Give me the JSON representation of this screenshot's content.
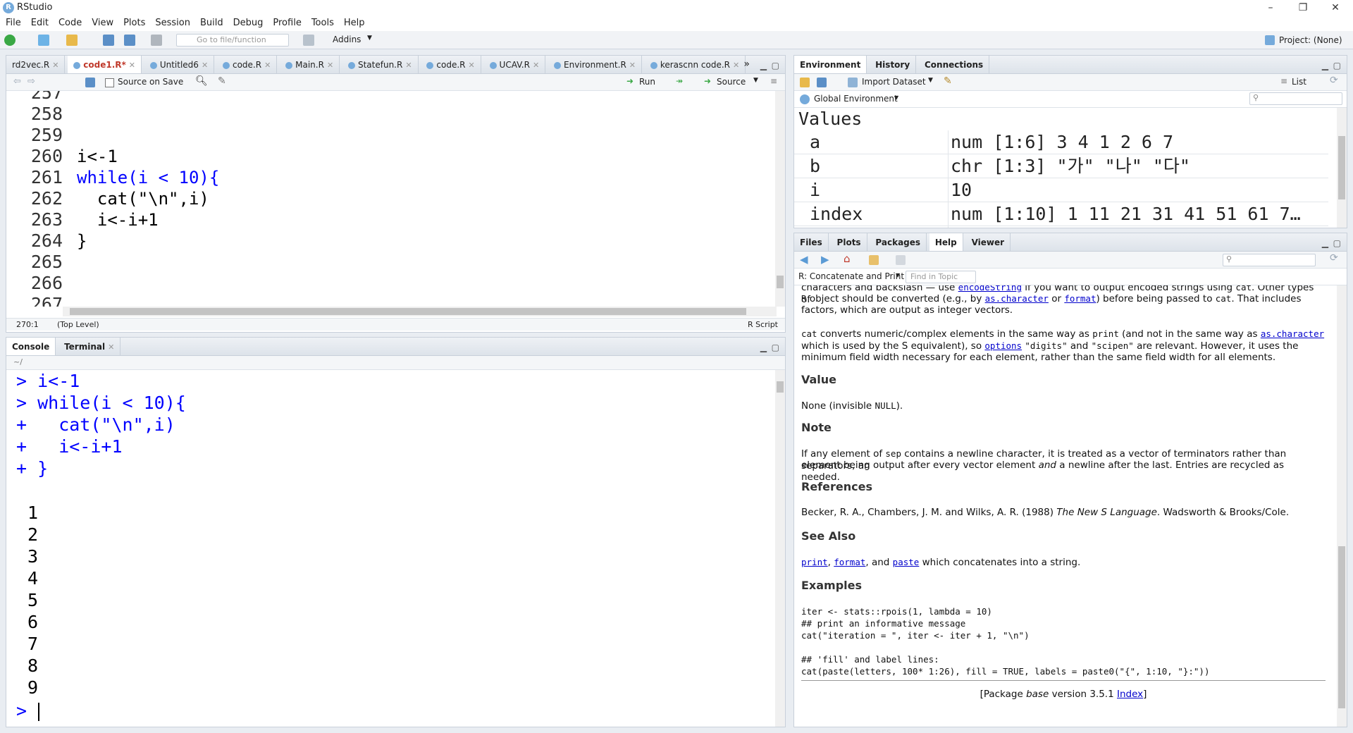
{
  "window": {
    "title": "RStudio",
    "minimize": "–",
    "restore": "❐",
    "close": "✕"
  },
  "menu": [
    "File",
    "Edit",
    "Code",
    "View",
    "Plots",
    "Session",
    "Build",
    "Debug",
    "Profile",
    "Tools",
    "Help"
  ],
  "toolbar": {
    "goto_placeholder": "Go to file/function",
    "addins": "Addins",
    "project": "Project: (None)"
  },
  "editor": {
    "tabs": [
      "rd2vec.R",
      "code1.R*",
      "Untitled6",
      "code.R",
      "Main.R",
      "Statefun.R",
      "code.R",
      "UCAV.R",
      "Environment.R",
      "kerascnn code.R"
    ],
    "active_tab": 1,
    "source_on_save": "Source on Save",
    "run": "Run",
    "source": "Source",
    "lines": [
      {
        "n": "258",
        "t": ""
      },
      {
        "n": "259",
        "t": ""
      },
      {
        "n": "260",
        "t": "i<-1"
      },
      {
        "n": "261",
        "t": "while(i < 10){"
      },
      {
        "n": "262",
        "t": "  cat(\"\\n\",i)"
      },
      {
        "n": "263",
        "t": "  i<-i+1"
      },
      {
        "n": "264",
        "t": "}"
      },
      {
        "n": "265",
        "t": ""
      },
      {
        "n": "266",
        "t": ""
      },
      {
        "n": "267",
        "t": ""
      }
    ],
    "cursor_pos": "270:1",
    "scope": "(Top Level)",
    "filetype": "R Script"
  },
  "console": {
    "tabs": [
      "Console",
      "Terminal"
    ],
    "path": "~/",
    "input_lines": [
      "> i<-1",
      "> while(i < 10){",
      "+   cat(\"\\n\",i)",
      "+   i<-i+1",
      "+ }"
    ],
    "output": [
      "1",
      "2",
      "3",
      "4",
      "5",
      "6",
      "7",
      "8",
      "9"
    ],
    "prompt": ">"
  },
  "environment": {
    "tabs": [
      "Environment",
      "History",
      "Connections"
    ],
    "import": "Import Dataset",
    "view": "List",
    "scope": "Global Environment",
    "section": "Values",
    "rows": [
      {
        "name": "a",
        "value": "num [1:6] 3 4 1 2 6 7"
      },
      {
        "name": "b",
        "value": "chr [1:3] \"가\" \"나\" \"다\""
      },
      {
        "name": "i",
        "value": "10"
      },
      {
        "name": "index",
        "value": "num [1:10] 1 11 21 31 41 51 61 7…"
      }
    ]
  },
  "help": {
    "tabs": [
      "Files",
      "Plots",
      "Packages",
      "Help",
      "Viewer"
    ],
    "topic": "R: Concatenate and Print",
    "find_placeholder": "Find in Topic",
    "p0a": "characters and backslash — use",
    "p0_link": "encodeString",
    "p0b": "if you want to output encoded strings using",
    "p0_code": "cat",
    "p0c": ". Other types of",
    "p1a": "R",
    "p1b": "object should be converted (e.g., by",
    "p1_link1": "as.character",
    "p1c": "or",
    "p1_link2": "format",
    "p1d": ") before being passed to",
    "p1e": "cat",
    "p1f": ". That includes",
    "p2": "factors, which are output as integer vectors.",
    "p3a": "cat",
    "p3b": "converts numeric/complex elements in the same way as",
    "p3c": "print",
    "p3d": "(and not in the same way as",
    "p3_link": "as.character",
    "p4a": "which is used by the S equivalent), so",
    "p4_link": "options",
    "p4b": "\"digits\"",
    "p4c": "and",
    "p4d": "\"scipen\"",
    "p4e": "are relevant. However, it uses the",
    "p5": "minimum field width necessary for each element, rather than the same field width for all elements.",
    "h_value": "Value",
    "value_a": "None (invisible",
    "value_code": "NULL",
    "value_b": ").",
    "h_note": "Note",
    "note1a": "If any element of",
    "note1_code": "sep",
    "note1b": "contains a newline character, it is treated as a vector of terminators rather than separators, an",
    "note2a": "element being output after every vector element",
    "note2_em": "and",
    "note2b": "a newline after the last. Entries are recycled as needed.",
    "h_refs": "References",
    "ref_a": "Becker, R. A., Chambers, J. M. and Wilks, A. R. (1988)",
    "ref_em": "The New S Language",
    "ref_b": ". Wadsworth & Brooks/Cole.",
    "h_see": "See Also",
    "see_link1": "print",
    "see_link2": "format",
    "see_and": ", and",
    "see_link3": "paste",
    "see_b": "which concatenates into a string.",
    "h_examples": "Examples",
    "ex": [
      "iter <- stats::rpois(1, lambda = 10)",
      "## print an informative message",
      "cat(\"iteration = \", iter <- iter + 1, \"\\n\")",
      "",
      "## 'fill' and label lines:",
      "cat(paste(letters, 100* 1:26), fill = TRUE, labels = paste0(\"{\", 1:10, \"}:\"))"
    ],
    "footer_a": "[Package",
    "footer_em": "base",
    "footer_b": "version 3.5.1",
    "footer_link": "Index",
    "footer_c": "]"
  }
}
